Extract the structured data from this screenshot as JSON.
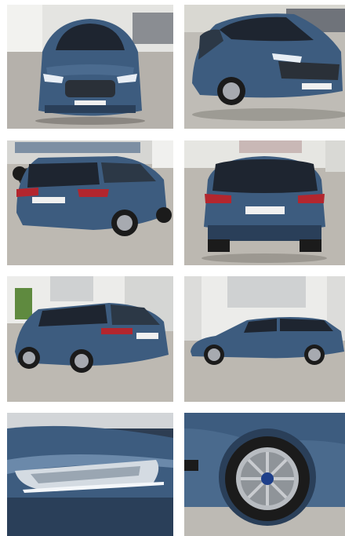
{
  "gallery": {
    "photos": [
      {
        "name": "front-view"
      },
      {
        "name": "front-three-quarter-view"
      },
      {
        "name": "rear-three-quarter-left-view"
      },
      {
        "name": "rear-view"
      },
      {
        "name": "rear-side-view"
      },
      {
        "name": "side-profile-view"
      },
      {
        "name": "headlight-detail"
      },
      {
        "name": "wheel-detail"
      }
    ],
    "plate_text": "",
    "colors": {
      "car_body": "#3d5c7f",
      "car_body_dark": "#2a3f59",
      "car_body_light": "#6b89aa",
      "glass": "#1e2530",
      "pavement": "#b9b6b0",
      "pavement_dark": "#8f8b85",
      "building": "#e8e8e4",
      "taillight": "#b3262e"
    }
  }
}
